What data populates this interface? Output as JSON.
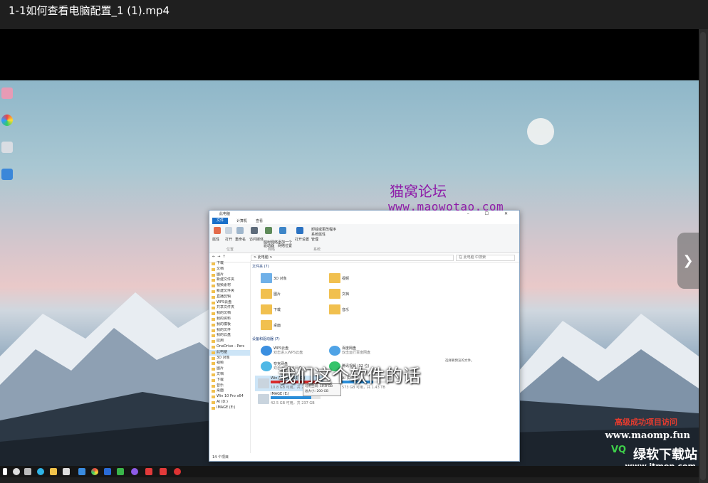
{
  "window": {
    "title": "1-1如何查看电脑配置_1 (1).mp4"
  },
  "video": {
    "subtitle": "我们这个软件的话",
    "forum_name": "猫窝论坛",
    "forum_url": "www.maowotao.com",
    "watermark_1": "高级成功项目访问",
    "watermark_2": "www.maomp.fun",
    "watermark_3": "VQ",
    "watermark_4": "绿软下载站",
    "watermark_5": "www.itmop.com",
    "next_icon": "chevron-right-icon"
  },
  "explorer": {
    "title": "此电脑",
    "controls": "–  ☐  ✕",
    "tabs": [
      "文件",
      "计算机",
      "查看"
    ],
    "ribbon": {
      "groups": [
        "位置",
        "网络",
        "系统"
      ],
      "buttons": [
        "属性",
        "打开",
        "重命名",
        "访问媒体",
        "映射网络驱动器",
        "添加一个网络位置",
        "打开设置"
      ],
      "system_items": [
        "卸载或更改程序",
        "系统属性",
        "管理"
      ]
    },
    "address": "> 此电脑 >",
    "search_placeholder": "在 此电脑 中搜索",
    "nav": [
      {
        "label": "下载",
        "selected": false
      },
      {
        "label": "文档",
        "selected": false
      },
      {
        "label": "图片",
        "selected": false
      },
      {
        "label": "新建文件夹",
        "selected": false
      },
      {
        "label": "视频素材",
        "selected": false
      },
      {
        "label": "新建文件夹",
        "selected": false
      },
      {
        "label": "直播剪辑",
        "selected": false
      },
      {
        "label": "WPS云盘",
        "selected": false
      },
      {
        "label": "共享文件夹",
        "selected": false
      },
      {
        "label": "我的文档",
        "selected": false
      },
      {
        "label": "我的资料",
        "selected": false
      },
      {
        "label": "我的模板",
        "selected": false
      },
      {
        "label": "我的文件",
        "selected": false
      },
      {
        "label": "我的云盘",
        "selected": false
      },
      {
        "label": "应用",
        "selected": false
      },
      {
        "label": "OneDrive - Pers",
        "selected": false
      },
      {
        "label": "此电脑",
        "selected": true
      },
      {
        "label": "3D 对象",
        "selected": false
      },
      {
        "label": "视频",
        "selected": false
      },
      {
        "label": "图片",
        "selected": false
      },
      {
        "label": "文档",
        "selected": false
      },
      {
        "label": "下载",
        "selected": false
      },
      {
        "label": "音乐",
        "selected": false
      },
      {
        "label": "桌面",
        "selected": false
      },
      {
        "label": "Win 10 Pro x64",
        "selected": false
      },
      {
        "label": "AI (D:)",
        "selected": false
      },
      {
        "label": "IMAGE (E:)",
        "selected": false
      }
    ],
    "folders_header": "文件夹 (7)",
    "folders": [
      "3D 对象",
      "视频",
      "图片",
      "文档",
      "下载",
      "音乐",
      "桌面"
    ],
    "devices_header": "设备和驱动器 (7)",
    "devices": [
      {
        "name": "WPS云盘",
        "sub": "双击进入WPS云盘"
      },
      {
        "name": "百度网盘",
        "sub": "双击运行百度网盘"
      },
      {
        "name": "夸克网盘",
        "sub": "双击运行夸克网盘"
      },
      {
        "name": "腾讯视频 (32 位)",
        "sub": ""
      }
    ],
    "drives": [
      {
        "name": "Win 10 Pro x64 (C:)",
        "info": "10.8 GB 可用，共 200 GB",
        "used": 0.95,
        "color": "#d92b2b"
      },
      {
        "name": "AI (D:)",
        "info": "573 GB 可用，共 1.43 TB",
        "used": 0.6,
        "color": "#2b8ed9"
      },
      {
        "name": "IMAGE (E:)",
        "info": "42.5 GB 可用，共 237 GB",
        "used": 0.82,
        "color": "#2b8ed9"
      }
    ],
    "tooltip_lines": [
      "可用空间: 10.8 GB",
      "总大小: 200 GB"
    ],
    "side_text": "选择要预览的文件。",
    "status": "14 个项目"
  },
  "colors": {
    "accent": "#1a6fc9",
    "forum": "#8e1ca8"
  }
}
